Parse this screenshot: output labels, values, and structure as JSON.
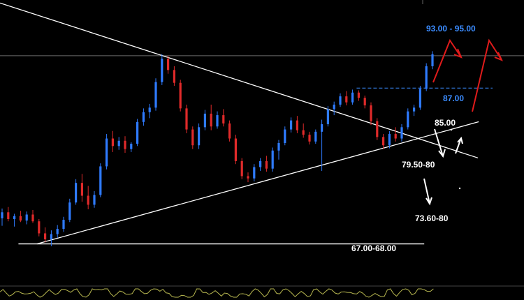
{
  "chart_data": {
    "type": "candlestick",
    "title": "",
    "xlabel": "",
    "ylabel": "",
    "ylim": [
      62,
      100
    ],
    "colors": {
      "background": "#000000",
      "up": "#2f7bff",
      "down": "#e02a2a",
      "lines": "#ffffff",
      "target_blue": "#3b8cff",
      "target_red": "#e01b1b",
      "oscillator": "#b8b850"
    },
    "series": [
      {
        "name": "",
        "values": [
          {
            "o": 71.0,
            "h": 72.3,
            "l": 70.0,
            "c": 71.8
          },
          {
            "o": 71.8,
            "h": 72.5,
            "l": 70.6,
            "c": 70.9
          },
          {
            "o": 70.9,
            "h": 71.6,
            "l": 69.9,
            "c": 71.3
          },
          {
            "o": 71.3,
            "h": 72.0,
            "l": 70.5,
            "c": 70.7
          },
          {
            "o": 70.7,
            "h": 71.9,
            "l": 70.2,
            "c": 71.5
          },
          {
            "o": 71.5,
            "h": 72.1,
            "l": 70.4,
            "c": 70.6
          },
          {
            "o": 70.6,
            "h": 70.9,
            "l": 68.6,
            "c": 69.0
          },
          {
            "o": 69.0,
            "h": 69.8,
            "l": 67.8,
            "c": 68.2
          },
          {
            "o": 68.2,
            "h": 69.4,
            "l": 67.3,
            "c": 68.9
          },
          {
            "o": 68.9,
            "h": 70.1,
            "l": 68.4,
            "c": 69.6
          },
          {
            "o": 69.6,
            "h": 71.2,
            "l": 69.2,
            "c": 70.8
          },
          {
            "o": 70.8,
            "h": 73.6,
            "l": 70.5,
            "c": 73.1
          },
          {
            "o": 73.1,
            "h": 76.2,
            "l": 72.8,
            "c": 75.7
          },
          {
            "o": 75.7,
            "h": 76.9,
            "l": 73.2,
            "c": 74.0
          },
          {
            "o": 74.0,
            "h": 75.3,
            "l": 72.2,
            "c": 72.8
          },
          {
            "o": 72.8,
            "h": 74.6,
            "l": 72.4,
            "c": 74.1
          },
          {
            "o": 74.1,
            "h": 78.3,
            "l": 73.8,
            "c": 77.9
          },
          {
            "o": 77.9,
            "h": 82.2,
            "l": 77.5,
            "c": 81.6
          },
          {
            "o": 81.6,
            "h": 82.6,
            "l": 79.8,
            "c": 80.6
          },
          {
            "o": 80.6,
            "h": 81.8,
            "l": 80.1,
            "c": 81.3
          },
          {
            "o": 81.3,
            "h": 81.9,
            "l": 79.7,
            "c": 80.2
          },
          {
            "o": 80.2,
            "h": 81.1,
            "l": 79.8,
            "c": 80.9
          },
          {
            "o": 80.9,
            "h": 84.2,
            "l": 80.6,
            "c": 83.8
          },
          {
            "o": 83.8,
            "h": 85.6,
            "l": 83.3,
            "c": 85.1
          },
          {
            "o": 85.1,
            "h": 86.2,
            "l": 84.3,
            "c": 85.7
          },
          {
            "o": 85.7,
            "h": 89.6,
            "l": 85.3,
            "c": 89.1
          },
          {
            "o": 89.1,
            "h": 92.8,
            "l": 88.7,
            "c": 92.2
          },
          {
            "o": 92.2,
            "h": 92.6,
            "l": 90.2,
            "c": 90.7
          },
          {
            "o": 90.7,
            "h": 91.2,
            "l": 88.6,
            "c": 89.0
          },
          {
            "o": 89.0,
            "h": 89.4,
            "l": 85.2,
            "c": 85.6
          },
          {
            "o": 85.6,
            "h": 86.1,
            "l": 82.3,
            "c": 82.8
          },
          {
            "o": 82.8,
            "h": 83.2,
            "l": 80.2,
            "c": 80.7
          },
          {
            "o": 80.7,
            "h": 83.6,
            "l": 80.2,
            "c": 83.1
          },
          {
            "o": 83.1,
            "h": 85.4,
            "l": 82.7,
            "c": 84.9
          },
          {
            "o": 84.9,
            "h": 86.1,
            "l": 82.7,
            "c": 83.2
          },
          {
            "o": 83.2,
            "h": 85.2,
            "l": 82.9,
            "c": 84.7
          },
          {
            "o": 84.7,
            "h": 85.5,
            "l": 83.2,
            "c": 83.6
          },
          {
            "o": 83.6,
            "h": 84.0,
            "l": 81.2,
            "c": 81.6
          },
          {
            "o": 81.6,
            "h": 82.1,
            "l": 78.2,
            "c": 78.6
          },
          {
            "o": 78.6,
            "h": 79.0,
            "l": 76.2,
            "c": 76.6
          },
          {
            "o": 76.6,
            "h": 77.1,
            "l": 75.8,
            "c": 76.3
          },
          {
            "o": 76.3,
            "h": 78.2,
            "l": 75.9,
            "c": 77.8
          },
          {
            "o": 77.8,
            "h": 79.0,
            "l": 77.3,
            "c": 78.6
          },
          {
            "o": 78.6,
            "h": 79.3,
            "l": 77.2,
            "c": 77.6
          },
          {
            "o": 77.6,
            "h": 80.4,
            "l": 77.2,
            "c": 80.0
          },
          {
            "o": 80.0,
            "h": 81.4,
            "l": 78.8,
            "c": 81.0
          },
          {
            "o": 81.0,
            "h": 83.2,
            "l": 80.7,
            "c": 82.8
          },
          {
            "o": 82.8,
            "h": 84.4,
            "l": 82.4,
            "c": 84.0
          },
          {
            "o": 84.0,
            "h": 84.6,
            "l": 82.3,
            "c": 82.7
          },
          {
            "o": 82.7,
            "h": 83.6,
            "l": 81.7,
            "c": 82.1
          },
          {
            "o": 82.1,
            "h": 82.5,
            "l": 80.8,
            "c": 81.2
          },
          {
            "o": 81.2,
            "h": 82.8,
            "l": 80.9,
            "c": 82.5
          },
          {
            "o": 82.5,
            "h": 84.1,
            "l": 77.3,
            "c": 83.5
          },
          {
            "o": 83.5,
            "h": 85.9,
            "l": 83.2,
            "c": 85.5
          },
          {
            "o": 85.5,
            "h": 86.5,
            "l": 84.7,
            "c": 86.1
          },
          {
            "o": 86.1,
            "h": 87.6,
            "l": 85.8,
            "c": 87.2
          },
          {
            "o": 87.2,
            "h": 87.9,
            "l": 86.0,
            "c": 86.4
          },
          {
            "o": 86.4,
            "h": 88.1,
            "l": 86.1,
            "c": 87.7
          },
          {
            "o": 87.7,
            "h": 88.0,
            "l": 86.6,
            "c": 87.0
          },
          {
            "o": 87.0,
            "h": 87.3,
            "l": 85.6,
            "c": 86.0
          },
          {
            "o": 86.0,
            "h": 86.4,
            "l": 83.4,
            "c": 83.9
          },
          {
            "o": 83.9,
            "h": 84.3,
            "l": 81.4,
            "c": 81.8
          },
          {
            "o": 81.8,
            "h": 82.2,
            "l": 80.2,
            "c": 80.7
          },
          {
            "o": 80.7,
            "h": 82.6,
            "l": 80.3,
            "c": 82.2
          },
          {
            "o": 82.2,
            "h": 83.1,
            "l": 81.2,
            "c": 81.6
          },
          {
            "o": 81.6,
            "h": 83.5,
            "l": 81.2,
            "c": 83.1
          },
          {
            "o": 83.1,
            "h": 85.6,
            "l": 82.8,
            "c": 85.2
          },
          {
            "o": 85.2,
            "h": 86.1,
            "l": 84.6,
            "c": 85.7
          },
          {
            "o": 85.7,
            "h": 88.6,
            "l": 85.4,
            "c": 88.2
          },
          {
            "o": 88.2,
            "h": 91.6,
            "l": 87.9,
            "c": 91.2
          },
          {
            "o": 91.2,
            "h": 93.2,
            "l": 90.8,
            "c": 92.8
          }
        ]
      }
    ],
    "trendlines": [
      {
        "name": "upper",
        "from": [
          0,
          99.6
        ],
        "to": [
          68,
          81.6
        ]
      },
      {
        "name": "lower",
        "from": [
          6,
          67.6
        ],
        "to": [
          68,
          81.6
        ]
      },
      {
        "name": "support",
        "from": [
          3,
          67.6
        ],
        "to": [
          69,
          67.6
        ]
      }
    ],
    "reference_lines": [
      {
        "name": "resistance",
        "value": 92.6
      },
      {
        "name": "target-87",
        "value": 88.3,
        "start_index": 58
      }
    ],
    "annotations": [
      {
        "text": "93.00 - 95.00",
        "color": "#3b8cff"
      },
      {
        "text": "87.00",
        "color": "#3b8cff"
      },
      {
        "text": "85.00",
        "color": "#ffffff"
      },
      {
        "text": "79.50-80",
        "color": "#ffffff"
      },
      {
        "text": "73.60-80",
        "color": "#ffffff"
      },
      {
        "text": "67.00-68.00",
        "color": "#ffffff"
      }
    ]
  }
}
